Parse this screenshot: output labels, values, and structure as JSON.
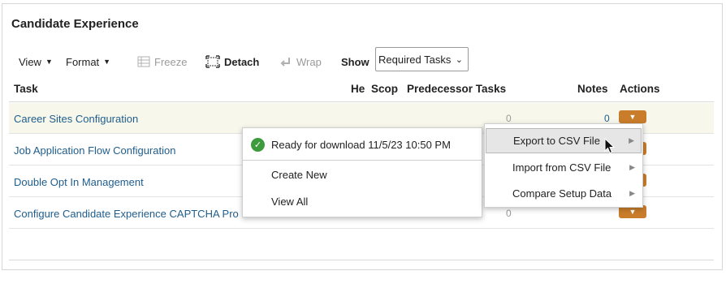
{
  "page": {
    "title": "Candidate Experience"
  },
  "toolbar": {
    "view": "View",
    "format": "Format",
    "freeze": "Freeze",
    "detach": "Detach",
    "wrap": "Wrap",
    "show": "Show",
    "show_select": "Required Tasks"
  },
  "table": {
    "columns": {
      "task": "Task",
      "he": "He",
      "scop": "Scop",
      "predecessor": "Predecessor Tasks",
      "notes": "Notes",
      "actions": "Actions"
    },
    "rows": [
      {
        "task": "Career Sites Configuration",
        "predecessor": "0",
        "notes": "0"
      },
      {
        "task": "Job Application Flow Configuration",
        "predecessor": "",
        "notes": ""
      },
      {
        "task": "Double Opt In Management",
        "predecessor": "",
        "notes": ""
      },
      {
        "task": "Configure Candidate Experience CAPTCHA Pro",
        "predecessor": "0",
        "notes": ""
      }
    ]
  },
  "popup": {
    "ready": "Ready for download 11/5/23 10:50 PM",
    "create_new": "Create New",
    "view_all": "View All"
  },
  "menu": {
    "export": "Export to CSV File",
    "import": "Import from CSV File",
    "compare": "Compare Setup Data"
  },
  "colors": {
    "link": "#1f5d8c",
    "action": "#c97d2b",
    "success": "#3d9a3d"
  }
}
